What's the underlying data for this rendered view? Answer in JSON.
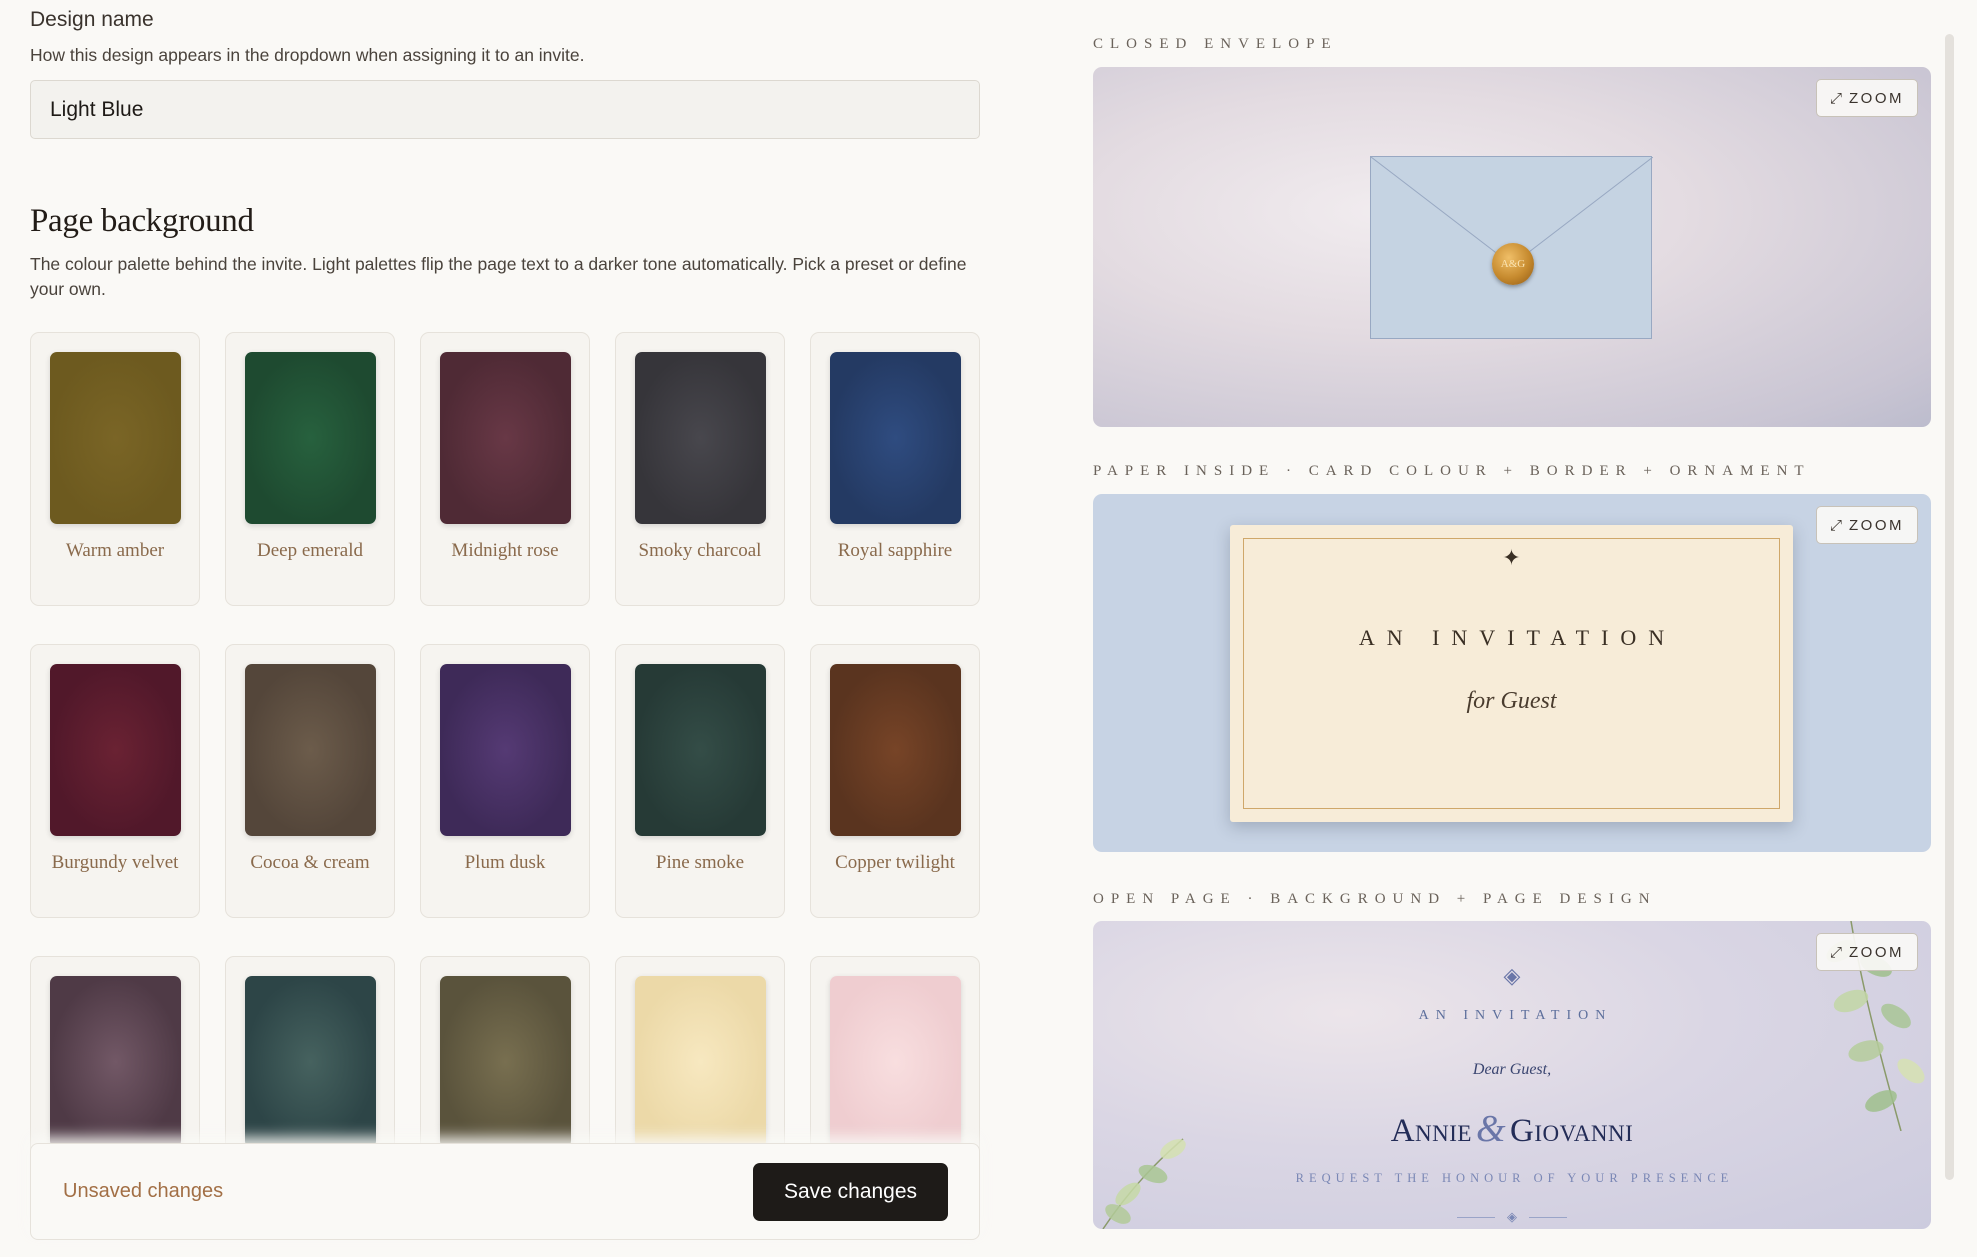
{
  "design_name": {
    "label": "Design name",
    "help": "How this design appears in the dropdown when assigning it to an invite.",
    "value": "Light Blue"
  },
  "page_background": {
    "title": "Page background",
    "help": "The colour palette behind the invite. Light palettes flip the page text to a darker tone automatically. Pick a preset or define your own.",
    "presets": [
      {
        "label": "Warm amber",
        "color": "#6d5a1f",
        "inner": "#7a6526"
      },
      {
        "label": "Deep emerald",
        "color": "#1e4a30",
        "inner": "#27613e"
      },
      {
        "label": "Midnight rose",
        "color": "#4f2a35",
        "inner": "#683846"
      },
      {
        "label": "Smoky charcoal",
        "color": "#36353a",
        "inner": "#48474d"
      },
      {
        "label": "Royal sapphire",
        "color": "#243a63",
        "inner": "#2f4c80"
      },
      {
        "label": "Burgundy velvet",
        "color": "#51182a",
        "inner": "#6a2233"
      },
      {
        "label": "Cocoa & cream",
        "color": "#54463a",
        "inner": "#6c5c4b"
      },
      {
        "label": "Plum dusk",
        "color": "#3e2a58",
        "inner": "#553a74"
      },
      {
        "label": "Pine smoke",
        "color": "#263a36",
        "inner": "#344d47"
      },
      {
        "label": "Copper twilight",
        "color": "#5a341f",
        "inner": "#774427"
      },
      {
        "label": "",
        "color": "#4f3a46",
        "inner": "#725866"
      },
      {
        "label": "",
        "color": "#2d4547",
        "inner": "#46625f"
      },
      {
        "label": "",
        "color": "#5a533c",
        "inner": "#786f50"
      },
      {
        "label": "",
        "color": "#ecd9a8",
        "inner": "#f7e8c0"
      },
      {
        "label": "",
        "color": "#efcdd0",
        "inner": "#f8dedf"
      }
    ]
  },
  "footer": {
    "status": "Unsaved changes",
    "save_label": "Save changes"
  },
  "previews": {
    "zoom_label": "ZOOM",
    "closed_envelope": {
      "label": "CLOSED ENVELOPE",
      "envelope_color": "#c5d3e2",
      "seal_text": "A&G"
    },
    "paper_inside": {
      "label": "PAPER INSIDE · CARD COLOUR + BORDER + ORNAMENT",
      "background_color": "#c7d3e4",
      "card_color": "#f7ecd8",
      "card_title": "AN INVITATION",
      "card_subtitle": "for Guest"
    },
    "open_page": {
      "label": "OPEN PAGE · BACKGROUND + PAGE DESIGN",
      "invitation": "AN INVITATION",
      "greeting": "Dear Guest,",
      "name_1": "Annie",
      "ampersand": "&",
      "name_2": "Giovanni",
      "request_line": "REQUEST THE HONOUR OF YOUR PRESENCE"
    }
  }
}
